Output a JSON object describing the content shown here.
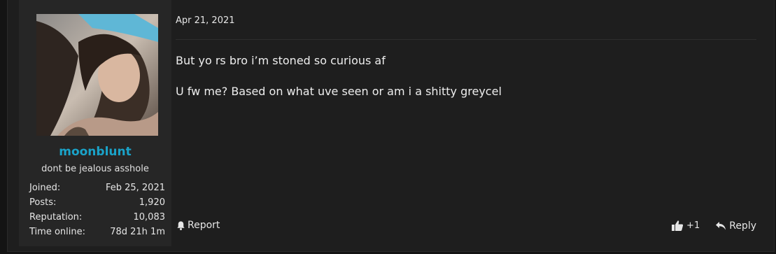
{
  "user": {
    "username": "moonblunt",
    "title": "dont be jealous asshole",
    "stats": [
      {
        "label": "Joined:",
        "value": "Feb 25, 2021"
      },
      {
        "label": "Posts:",
        "value": "1,920"
      },
      {
        "label": "Reputation:",
        "value": "10,083"
      },
      {
        "label": "Time online:",
        "value": "78d 21h 1m"
      }
    ],
    "username_color": "#1aa3c9"
  },
  "post": {
    "date": "Apr 21, 2021",
    "paragraphs": [
      "But yo rs bro i’m stoned so curious af",
      "U fw me? Based on what uve seen or am i a shitty greycel"
    ]
  },
  "actions": {
    "report_label": "Report",
    "like_count": "+1",
    "reply_label": "Reply",
    "report_icon": "bell-icon",
    "like_icon": "thumbs-up-icon",
    "reply_icon": "reply-arrow-icon"
  }
}
